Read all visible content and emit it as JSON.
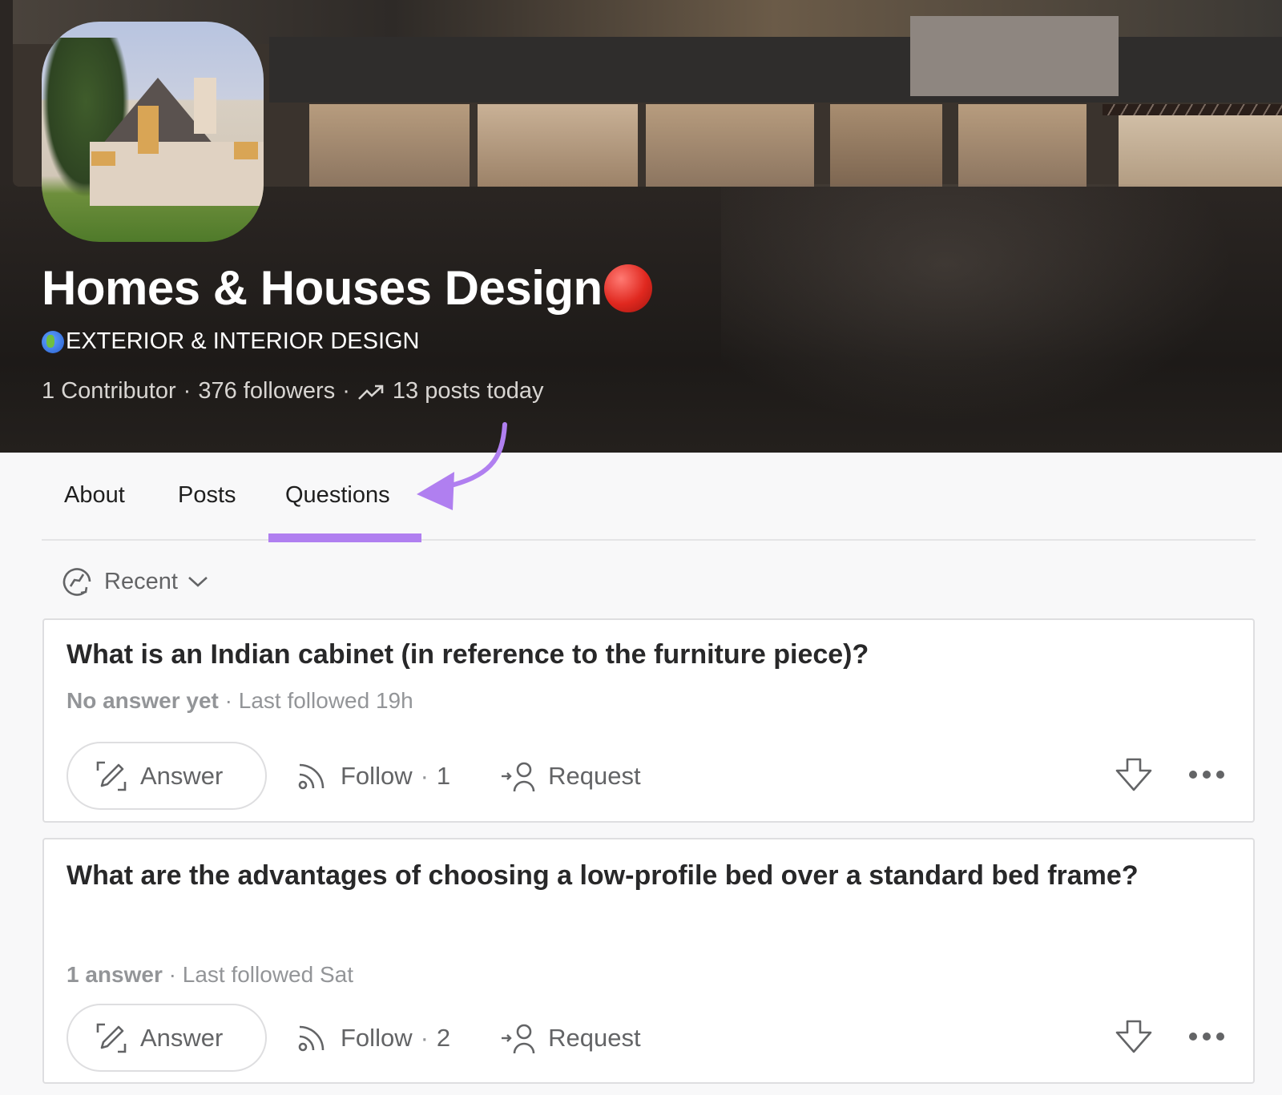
{
  "space": {
    "name": "Homes & Houses Design",
    "name_emoji": "red-circle",
    "tagline": "EXTERIOR & INTERIOR DESIGN",
    "tagline_emoji": "globe-americas",
    "contributors": "1 Contributor",
    "followers": "376 followers",
    "posts_today": "13 posts today",
    "separator": "·"
  },
  "tabs": [
    {
      "label": "About",
      "active": false
    },
    {
      "label": "Posts",
      "active": false
    },
    {
      "label": "Questions",
      "active": true
    }
  ],
  "accent_color": "#b07ff0",
  "sort": {
    "label": "Recent",
    "icon": "clock-refresh-icon"
  },
  "questions": [
    {
      "title": "What is an Indian cabinet (in reference to the furniture piece)?",
      "answer_status": "No answer yet",
      "last_followed": "Last followed 19h",
      "answer_label": "Answer",
      "follow_label": "Follow",
      "follow_count": "1",
      "request_label": "Request"
    },
    {
      "title": "What are the advantages of choosing a low-profile bed over a standard bed frame?",
      "answer_status": "1 answer",
      "last_followed": "Last followed Sat",
      "answer_label": "Answer",
      "follow_label": "Follow",
      "follow_count": "2",
      "request_label": "Request"
    }
  ]
}
